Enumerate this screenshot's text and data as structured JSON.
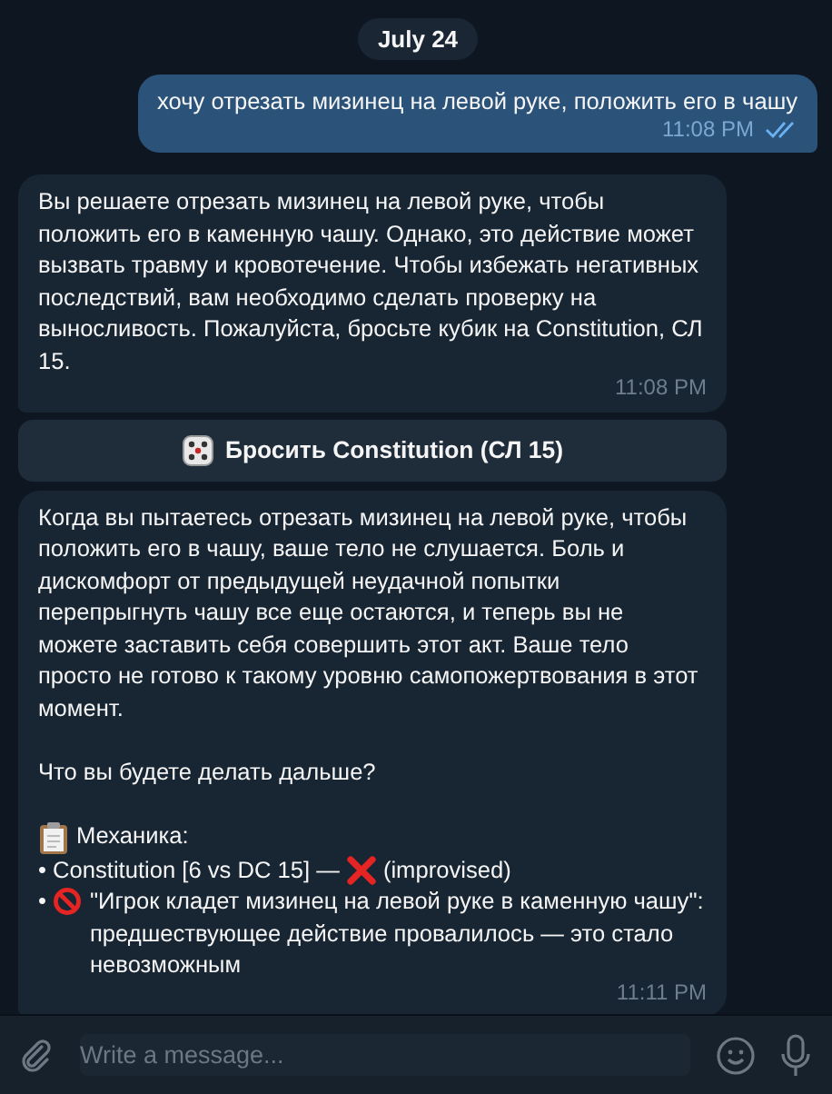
{
  "date": "July 24",
  "messages": [
    {
      "kind": "outgoing",
      "text": "хочу отрезать мизинец на левой руке, положить его в чашу",
      "time": "11:08 PM",
      "read": true
    },
    {
      "kind": "incoming",
      "text": "Вы решаете отрезать мизинец на левой руке, чтобы положить его в каменную чашу. Однако, это действие может вызвать травму и кровотечение. Чтобы избежать негативных последствий, вам необходимо сделать проверку на выносливость. Пожалуйста, бросьте кубик на Constitution, СЛ 15.",
      "time": "11:08 PM"
    }
  ],
  "inline_button": {
    "label": "Бросить Constitution (СЛ 15)"
  },
  "reply": {
    "paragraphs": [
      "Когда вы пытаетесь отрезать мизинец на левой руке, чтобы положить его в чашу, ваше тело не слушается. Боль и дискомфорт от предыдущей неудачной попытки перепрыгнуть чашу все еще остаются, и теперь вы не можете заставить себя совершить этот акт. Ваше тело просто не готово к такому уровню самопожертвования в этот момент.",
      "Что вы будете делать дальше?"
    ],
    "lines": [
      {
        "parts": [
          {
            "kind": "clipboard"
          },
          {
            "kind": "text",
            "text": "Механика:"
          }
        ]
      },
      {
        "parts": [
          {
            "kind": "text",
            "text": "• Constitution [6 vs DC 15] —"
          },
          {
            "kind": "cross"
          },
          {
            "kind": "text",
            "text": "(improvised)"
          }
        ]
      },
      {
        "parts": [
          {
            "kind": "text",
            "text": "•"
          },
          {
            "kind": "prohibited"
          },
          {
            "kind": "text",
            "text": "\"Игрок кладет мизинец на левой руке в каменную чашу\": предшествующее действие провалилось — это стало невозможным"
          }
        ]
      }
    ],
    "time": "11:11 PM"
  },
  "composer": {
    "placeholder": "Write a message..."
  }
}
